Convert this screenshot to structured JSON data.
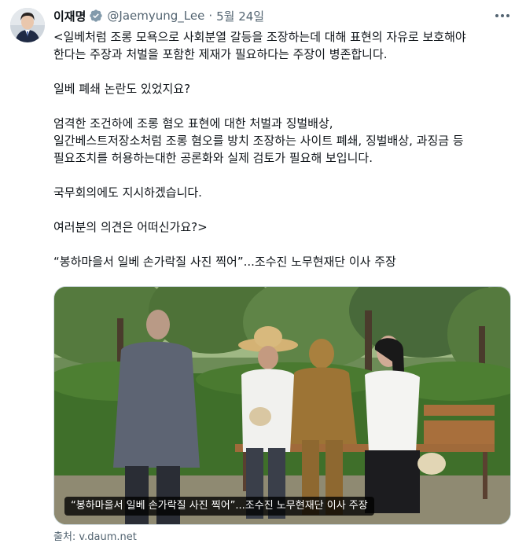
{
  "tweet": {
    "author_name": "이재명",
    "handle": "@Jaemyung_Lee",
    "separator": "·",
    "date": "5월 24일",
    "verified_icon": "verified-badge-icon",
    "more_icon": "more-options-icon",
    "paragraphs": [
      "<일베처럼 조롱 모욕으로 사회분열 갈등을 조장하는데 대해 표현의 자유로 보호해야\n한다는 주장과 처벌을 포함한 제재가 필요하다는 주장이 병존합니다.",
      "일베 폐쇄 논란도 있었지요?",
      "엄격한 조건하에 조롱 혐오 표현에 대한 처벌과 징벌배상,\n일간베스트저장소처럼 조롱 혐오를 방치 조장하는 사이트 폐쇄, 징벌배상, 과징금 등\n필요조치를 허용하는대한 공론화와 실제 검토가 필요해 보입니다.",
      "국무회의에도 지시하겠습니다.",
      "여러분의 의견은 어떠신가요?>",
      "“봉하마을서 일베 손가락질 사진 찍어”...조수진 노무현재단 이사 주장"
    ],
    "card": {
      "caption": "“봉하마을서 일베 손가락질 사진 찍어”...조수진 노무현재단 이사 주장",
      "source": "출처: v.daum.net"
    }
  },
  "colors": {
    "text": "#0f1419",
    "secondary": "#536471",
    "verified": "#829aab",
    "border": "#cfd9de"
  }
}
